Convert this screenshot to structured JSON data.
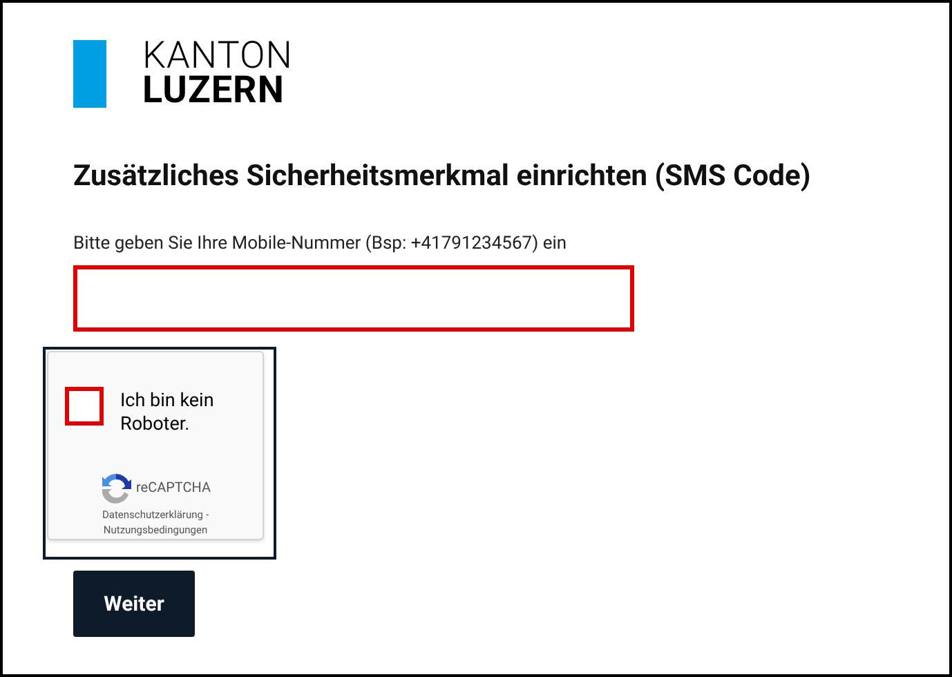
{
  "logo": {
    "line_1": "KANTON",
    "line_2": "LUZERN"
  },
  "heading": "Zusätzliches Sicherheitsmerkmal einrichten (SMS Code)",
  "phone_field": {
    "label": "Bitte geben Sie Ihre Mobile-Nummer (Bsp: +41791234567) ein"
  },
  "captcha": {
    "checked": false,
    "label": "Ich bin kein Roboter.",
    "brand": "reCAPTCHA",
    "privacy": "Datenschutzerklärung",
    "separator": "-",
    "terms": "Nutzungsbedingungen"
  },
  "submit_button": "Weiter"
}
